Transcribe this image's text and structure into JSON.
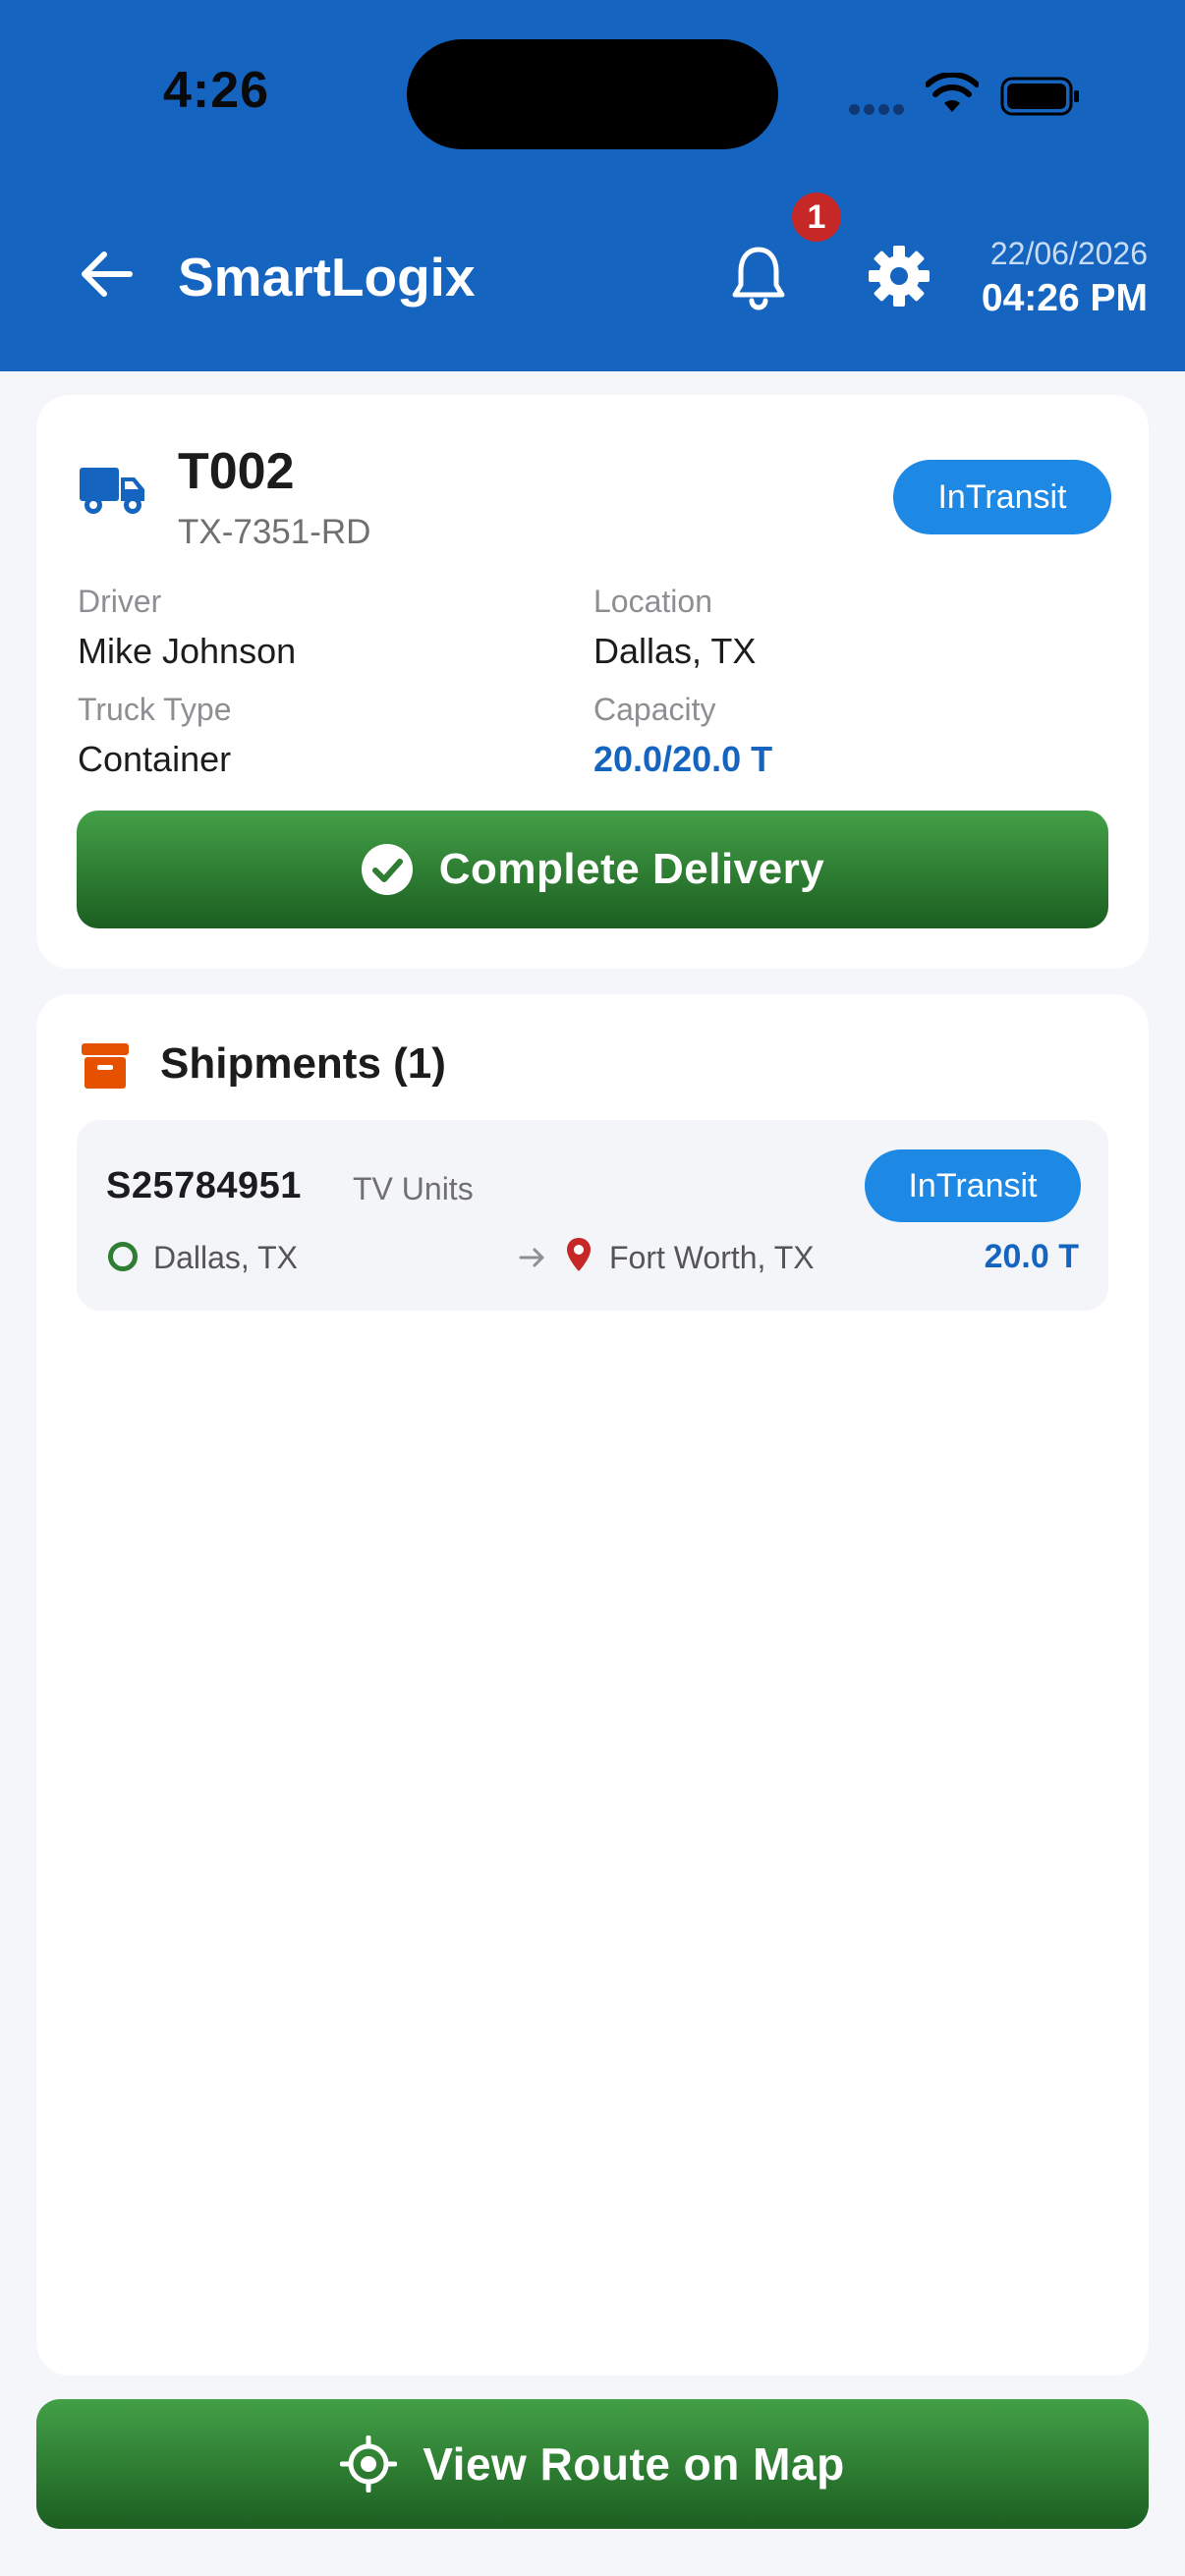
{
  "status_bar": {
    "time": "4:26"
  },
  "header": {
    "title": "SmartLogix",
    "notification_count": "1",
    "date": "22/06/2026",
    "time": "04:26 PM"
  },
  "truck": {
    "id": "T002",
    "plate": "TX-7351-RD",
    "status": "InTransit",
    "driver_label": "Driver",
    "driver": "Mike Johnson",
    "location_label": "Location",
    "location": "Dallas, TX",
    "type_label": "Truck Type",
    "type": "Container",
    "capacity_label": "Capacity",
    "capacity": "20.0/20.0 T",
    "complete_button": "Complete Delivery"
  },
  "shipments": {
    "title": "Shipments (1)",
    "items": [
      {
        "id": "S25784951",
        "description": "TV Units",
        "status": "InTransit",
        "origin": "Dallas, TX",
        "destination": "Fort Worth, TX",
        "weight": "20.0 T"
      }
    ]
  },
  "footer": {
    "map_button": "View Route on Map"
  },
  "colors": {
    "header_blue": "#1565c0",
    "status_pill": "#1e88e5",
    "action_green": "#2e7d32",
    "badge_red": "#c62828",
    "shipment_icon": "#e65100"
  },
  "icons": [
    "back-arrow-icon",
    "bell-icon",
    "gear-icon",
    "truck-icon",
    "check-circle-icon",
    "archive-box-icon",
    "origin-circle-icon",
    "arrow-right-icon",
    "location-pin-icon",
    "crosshair-icon",
    "wifi-icon",
    "battery-icon"
  ]
}
